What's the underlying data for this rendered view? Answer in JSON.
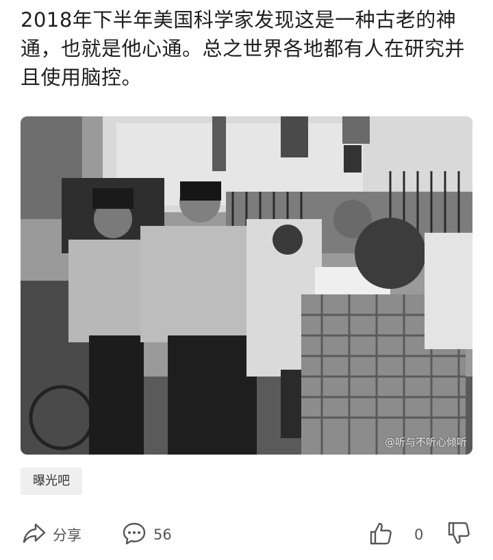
{
  "post": {
    "text": "2018年下半年美国科学家发现这是一种古老的神通，也就是他心通。总之世界各地都有人在研究并且使用脑控。"
  },
  "image": {
    "alt_icon": "photo",
    "watermark": "@听与不听心倾听"
  },
  "topic_tag": "曝光吧",
  "actions": {
    "share_label": "分享",
    "comment_count": "56",
    "like_count": "0"
  },
  "icons": {
    "share": "share-icon",
    "comment": "comment-icon",
    "like": "thumbs-up-icon",
    "dislike": "thumbs-down-icon"
  }
}
